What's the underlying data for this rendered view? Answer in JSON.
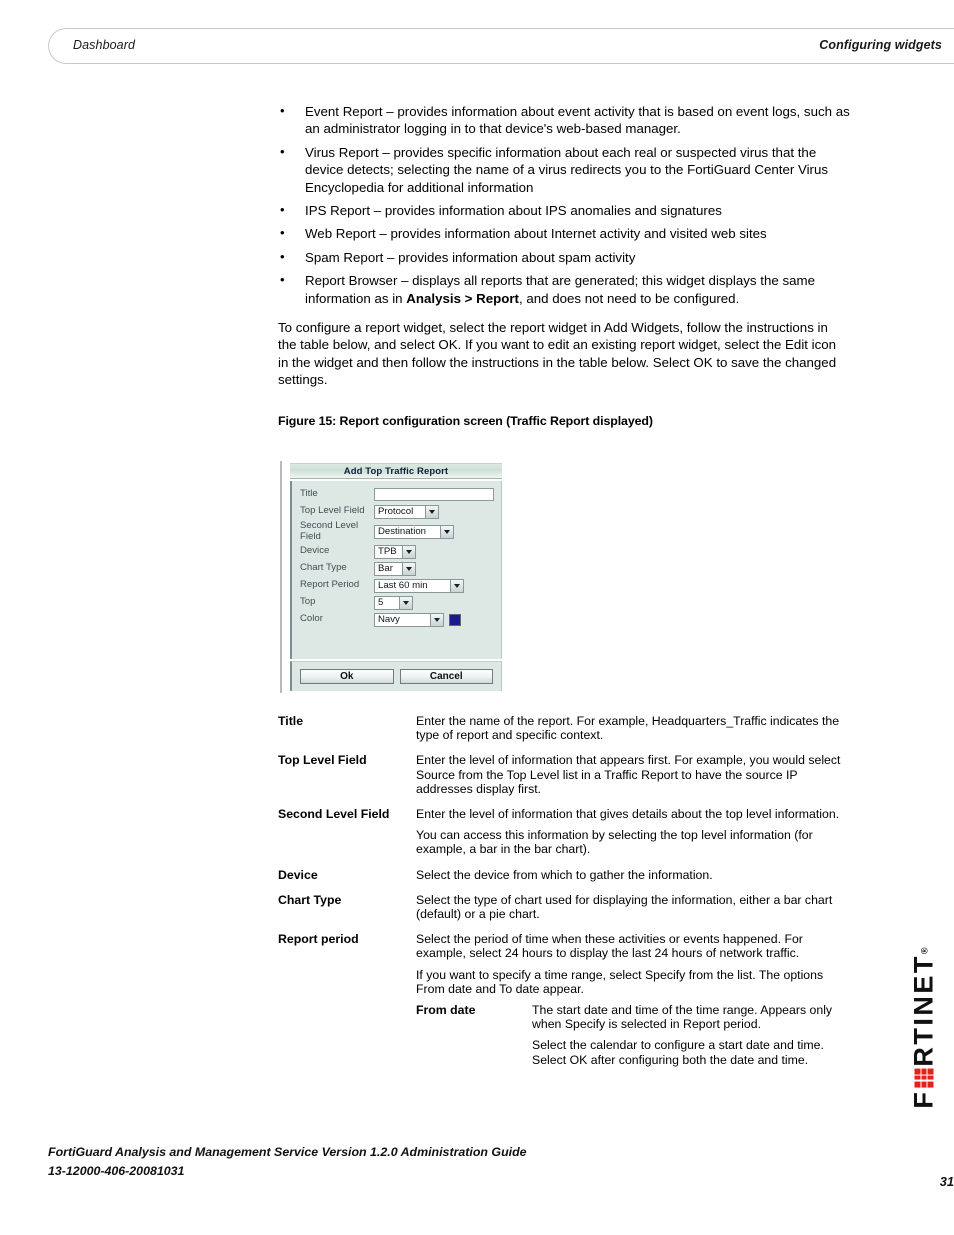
{
  "header": {
    "left": "Dashboard",
    "right": "Configuring widgets"
  },
  "bullets": [
    {
      "pre": "Event Report – provides information about event activity that is based on event logs, such as an administrator logging in to that device's web-based manager.",
      "bold": "",
      "post": ""
    },
    {
      "pre": "Virus Report – provides specific information about each real or suspected virus that the device detects; selecting the name of a virus redirects you to the FortiGuard Center Virus Encyclopedia for additional information",
      "bold": "",
      "post": ""
    },
    {
      "pre": "IPS Report – provides information about IPS anomalies and signatures",
      "bold": "",
      "post": ""
    },
    {
      "pre": "Web Report – provides information about Internet activity and visited web sites",
      "bold": "",
      "post": ""
    },
    {
      "pre": "Spam Report – provides information about spam activity",
      "bold": "",
      "post": ""
    },
    {
      "pre": "Report Browser – displays all reports that are generated; this widget displays the same information as in ",
      "bold": "Analysis > Report",
      "post": ", and does not need to be configured."
    }
  ],
  "paragraph": "To configure a report widget, select the report widget in Add Widgets, follow the instructions in the table below, and select OK. If you want to edit an existing report widget, select the Edit icon in the widget and then follow the instructions in the table below. Select OK to save the changed settings.",
  "figure_caption": "Figure 15: Report configuration screen (Traffic Report displayed)",
  "dialog": {
    "title": "Add Top Traffic Report",
    "fields": {
      "title_label": "Title",
      "title_value": "",
      "top_level_label": "Top Level Field",
      "top_level_value": "Protocol",
      "second_level_label": "Second Level Field",
      "second_level_value": "Destination",
      "device_label": "Device",
      "device_value": "TPB",
      "chart_type_label": "Chart Type",
      "chart_type_value": "Bar",
      "report_period_label": "Report Period",
      "report_period_value": "Last 60 min",
      "top_label": "Top",
      "top_value": "5",
      "color_label": "Color",
      "color_value": "Navy",
      "color_swatch_hex": "#1a1a8c"
    },
    "ok_label": "Ok",
    "cancel_label": "Cancel"
  },
  "definitions": [
    {
      "term": "Title",
      "paragraphs": [
        "Enter the name of the report. For example, Headquarters_Traffic indicates the type of report and specific context."
      ]
    },
    {
      "term": "Top Level Field",
      "paragraphs": [
        "Enter the level of information that appears first. For example, you would select Source from the Top Level list in a Traffic Report to have the source IP addresses display first."
      ]
    },
    {
      "term": "Second Level Field",
      "paragraphs": [
        "Enter the level of information that gives details about the top level information.",
        "You can access this information by selecting the top level information (for example, a bar in the bar chart)."
      ]
    },
    {
      "term": "Device",
      "paragraphs": [
        "Select the device from which to gather the information."
      ]
    },
    {
      "term": "Chart Type",
      "paragraphs": [
        "Select the type of chart used for displaying the information, either a bar chart (default) or a pie chart."
      ]
    },
    {
      "term": "Report period",
      "paragraphs": [
        "Select the period of time when these activities or events happened. For example, select 24 hours to display the last 24 hours of network traffic.",
        "If you want to specify a time range, select Specify from the list. The options From date and To date appear."
      ],
      "sub": {
        "term": "From date",
        "paragraphs": [
          "The start date and time of the time range. Appears only when Specify is selected in Report period.",
          "Select the calendar to configure a start date and time. Select OK after configuring both the date and time."
        ]
      }
    }
  ],
  "logo": {
    "text_before": "F",
    "text_after": "RTINET",
    "trademark": "®",
    "accent_hex": "#e2231a"
  },
  "footer": {
    "line1": "FortiGuard Analysis and Management Service Version 1.2.0 Administration Guide",
    "line2": "13-12000-406-20081031",
    "page_number": "31"
  }
}
